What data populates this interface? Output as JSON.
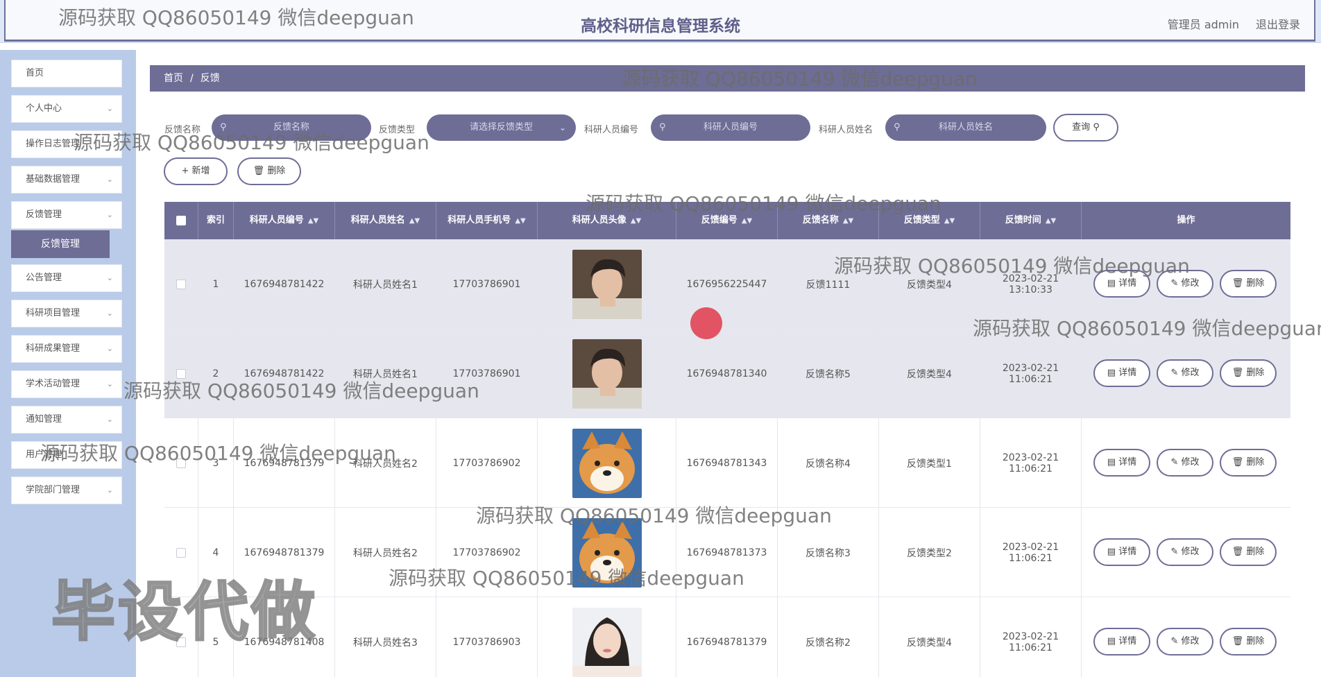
{
  "header": {
    "title": "高校科研信息管理系统",
    "user_label": "管理员 admin",
    "logout_label": "退出登录"
  },
  "sidebar": {
    "items": [
      {
        "label": "首页",
        "has_chevron": false
      },
      {
        "label": "个人中心",
        "has_chevron": true
      },
      {
        "label": "操作日志管理",
        "has_chevron": true
      },
      {
        "label": "基础数据管理",
        "has_chevron": true
      },
      {
        "label": "反馈管理",
        "has_chevron": true
      },
      {
        "label": "公告管理",
        "has_chevron": true
      },
      {
        "label": "科研项目管理",
        "has_chevron": true
      },
      {
        "label": "科研成果管理",
        "has_chevron": true
      },
      {
        "label": "学术活动管理",
        "has_chevron": true
      },
      {
        "label": "通知管理",
        "has_chevron": true
      },
      {
        "label": "用户管理",
        "has_chevron": true
      },
      {
        "label": "学院部门管理",
        "has_chevron": true
      }
    ],
    "active_sub": "反馈管理"
  },
  "breadcrumb": {
    "home": "首页",
    "sep": "/",
    "current": "反馈"
  },
  "filters": {
    "name_label": "反馈名称",
    "name_placeholder": "反馈名称",
    "type_label": "反馈类型",
    "type_placeholder": "请选择反馈类型",
    "staff_no_label": "科研人员编号",
    "staff_no_placeholder": "科研人员编号",
    "staff_name_label": "科研人员姓名",
    "staff_name_placeholder": "科研人员姓名",
    "search_button": "查询"
  },
  "toolbar": {
    "add_label": "新增",
    "delete_label": "删除"
  },
  "table": {
    "columns": [
      "索引",
      "科研人员编号",
      "科研人员姓名",
      "科研人员手机号",
      "科研人员头像",
      "反馈编号",
      "反馈名称",
      "反馈类型",
      "反馈时间",
      "操作"
    ],
    "rows": [
      {
        "index": "1",
        "staff_no": "1676948781422",
        "staff_name": "科研人员姓名1",
        "phone": "17703786901",
        "avatar": "young-man-photo",
        "fb_no": "1676956225447",
        "fb_name": "反馈1111",
        "fb_type": "反馈类型4",
        "time": "2023-02-21 13:10:33"
      },
      {
        "index": "2",
        "staff_no": "1676948781422",
        "staff_name": "科研人员姓名1",
        "phone": "17703786901",
        "avatar": "young-man-photo",
        "fb_no": "1676948781340",
        "fb_name": "反馈名称5",
        "fb_type": "反馈类型4",
        "time": "2023-02-21 11:06:21"
      },
      {
        "index": "3",
        "staff_no": "1676948781379",
        "staff_name": "科研人员姓名2",
        "phone": "17703786902",
        "avatar": "shiba-dog-photo",
        "fb_no": "1676948781343",
        "fb_name": "反馈名称4",
        "fb_type": "反馈类型1",
        "time": "2023-02-21 11:06:21"
      },
      {
        "index": "4",
        "staff_no": "1676948781379",
        "staff_name": "科研人员姓名2",
        "phone": "17703786902",
        "avatar": "shiba-dog-photo",
        "fb_no": "1676948781373",
        "fb_name": "反馈名称3",
        "fb_type": "反馈类型2",
        "time": "2023-02-21 11:06:21"
      },
      {
        "index": "5",
        "staff_no": "1676948781408",
        "staff_name": "科研人员姓名3",
        "phone": "17703786903",
        "avatar": "young-woman-photo",
        "fb_no": "1676948781379",
        "fb_name": "反馈名称2",
        "fb_type": "反馈类型4",
        "time": "2023-02-21 11:06:21"
      }
    ],
    "actions": {
      "detail": "详情",
      "edit": "修改",
      "delete": "删除"
    }
  },
  "watermarks": {
    "text": "源码获取 QQ86050149 微信deepguan",
    "big_text": "毕设代做"
  },
  "colors": {
    "accent": "#6e6d96",
    "sidebar_bg": "#b9cbe8",
    "row_shade": "#e6e7ee",
    "cursor": "#e0394a"
  }
}
